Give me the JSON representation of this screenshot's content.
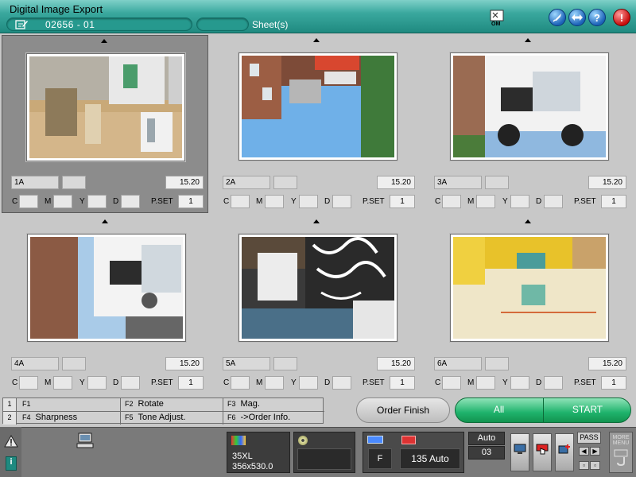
{
  "window": {
    "title": "Digital Image Export",
    "order_number": "02656  - 01",
    "sheet_count": "",
    "sheet_label": "Sheet(s)",
    "om_label": "OM",
    "help_label": "?",
    "alert_label": "!"
  },
  "frames": [
    {
      "id": "1A",
      "size": "15.20",
      "c": "",
      "m": "",
      "y": "",
      "d": "",
      "pset_label": "P.SET",
      "pset": "1",
      "selected": true,
      "icon": "photo-interior"
    },
    {
      "id": "2A",
      "size": "15.20",
      "c": "",
      "m": "",
      "y": "",
      "d": "",
      "pset_label": "P.SET",
      "pset": "1",
      "selected": false,
      "icon": "photo-street"
    },
    {
      "id": "3A",
      "size": "15.20",
      "c": "",
      "m": "",
      "y": "",
      "d": "",
      "pset_label": "P.SET",
      "pset": "1",
      "selected": false,
      "icon": "photo-van"
    },
    {
      "id": "4A",
      "size": "15.20",
      "c": "",
      "m": "",
      "y": "",
      "d": "",
      "pset_label": "P.SET",
      "pset": "1",
      "selected": false,
      "icon": "photo-van-street"
    },
    {
      "id": "5A",
      "size": "15.20",
      "c": "",
      "m": "",
      "y": "",
      "d": "",
      "pset_label": "P.SET",
      "pset": "1",
      "selected": false,
      "icon": "photo-graffiti"
    },
    {
      "id": "6A",
      "size": "15.20",
      "c": "",
      "m": "",
      "y": "",
      "d": "",
      "pset_label": "P.SET",
      "pset": "1",
      "selected": false,
      "icon": "photo-yellow-room"
    }
  ],
  "labels": {
    "c": "C",
    "m": "M",
    "y": "Y",
    "d": "D"
  },
  "fkeys": {
    "row1_num": "1",
    "row2_num": "2",
    "f1": {
      "key": "F1",
      "label": ""
    },
    "f2": {
      "key": "F2",
      "label": "Rotate"
    },
    "f3": {
      "key": "F3",
      "label": "Mag."
    },
    "f4": {
      "key": "F4",
      "label": "Sharpness"
    },
    "f5": {
      "key": "F5",
      "label": "Tone Adjust."
    },
    "f6": {
      "key": "F6",
      "label": "->Order Info."
    }
  },
  "actions": {
    "order_finish": "Order Finish",
    "all": "All",
    "start": "START"
  },
  "status": {
    "media_type": "35XL",
    "media_size": "356x530.0",
    "film_format": "F",
    "film_type": "135 Auto",
    "mode": "Auto",
    "count": "03",
    "pass_label": "PASS",
    "menu_label": "MORE MENU",
    "info_label": "i"
  },
  "colors": {
    "title_teal": "#1f8a80",
    "start_green": "#1fb36c",
    "alert_red": "#c80d0d",
    "help_blue": "#1c63b8"
  }
}
